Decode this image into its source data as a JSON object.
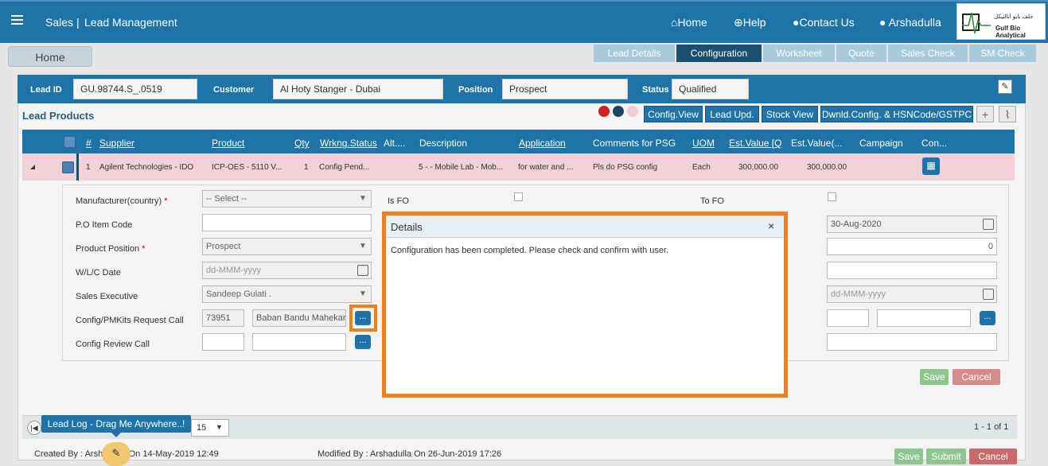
{
  "header": {
    "module": "Sales",
    "separator": "|",
    "title": "Lead Management",
    "nav": [
      "Home",
      "Help",
      "Contact Us"
    ],
    "user": "Arshadulla",
    "logo_ar": "جلف بايو انالتيكل",
    "logo_en": "Gulf Bio Analytical"
  },
  "home_tab": "Home",
  "stages": [
    {
      "label": "Lead Details",
      "active": false
    },
    {
      "label": "Configuration",
      "active": true
    },
    {
      "label": "Worksheet",
      "active": false
    },
    {
      "label": "Quote",
      "active": false
    },
    {
      "label": "Sales Check",
      "active": false
    },
    {
      "label": "SM Check",
      "active": false
    }
  ],
  "lead": {
    "id_label": "Lead ID",
    "id": "GU.98744.S_.0519",
    "customer_label": "Customer",
    "customer": "Al Hoty Stanger - Dubai",
    "position_label": "Position",
    "position": "Prospect",
    "status_label": "Status",
    "status": "Qualified"
  },
  "lead_products": {
    "title": "Lead Products",
    "buttons": [
      "Config.View",
      "Lead Upd.",
      "Stock View",
      "Dwnld.Config. & HSNCode/GSTPC"
    ]
  },
  "grid": {
    "columns": [
      "#",
      "Supplier",
      "Product",
      "Qty",
      "Wrkng.Status",
      "Alt....",
      "Description",
      "Application",
      "Comments for PSG",
      "UOM",
      "Est.Value [Q",
      "Est.Value(...",
      "Campaign",
      "Con..."
    ],
    "row": {
      "num": "1",
      "supplier": "Agilent Technologies - IDO",
      "product": "ICP-OES - 5110 V...",
      "qty": "1",
      "status": "Config Pend...",
      "desc": "5 - - Mobile Lab - Mob...",
      "application": "for water and ...",
      "comments": "Pls do PSG config",
      "uom": "Each",
      "est1": "300,000.00",
      "est2": "300,000.00"
    }
  },
  "form": {
    "manufacturer_label": "Manufacturer(country)",
    "manufacturer": "-- Select --",
    "is_fo": "Is FO",
    "to_fo": "To FO",
    "po_label": "P.O Item Code",
    "position_label": "Product Position",
    "position": "Prospect",
    "wlc_label": "W/L/C Date",
    "wlc_ph": "dd-MMM-yyyy",
    "exec_label": "Sales Executive",
    "exec": "Sandeep Gulati .",
    "config_label": "Config/PMKits Request Call",
    "config_id": "73951",
    "config_name": "Baban Bandu Mahekar",
    "review_label": "Config Review Call",
    "date1": "30-Aug-2020",
    "num1": "0",
    "date2_ph": "dd-MMM-yyyy",
    "save": "Save",
    "cancel": "Cancel",
    "dots": "..."
  },
  "pager": {
    "size": "15",
    "range": "1 - 1 of 1"
  },
  "lead_log": "Lead Log - Drag Me Anywhere..!",
  "footer": {
    "created": "Created By : Arshadulla On 14-May-2019 12:49",
    "modified": "Modified By : Arshadulla On 26-Jun-2019 17:26",
    "save": "Save",
    "submit": "Submit",
    "cancel": "Cancel"
  },
  "modal": {
    "title": "Details",
    "close": "×",
    "message": "Configuration has been completed. Please check and confirm with user."
  }
}
